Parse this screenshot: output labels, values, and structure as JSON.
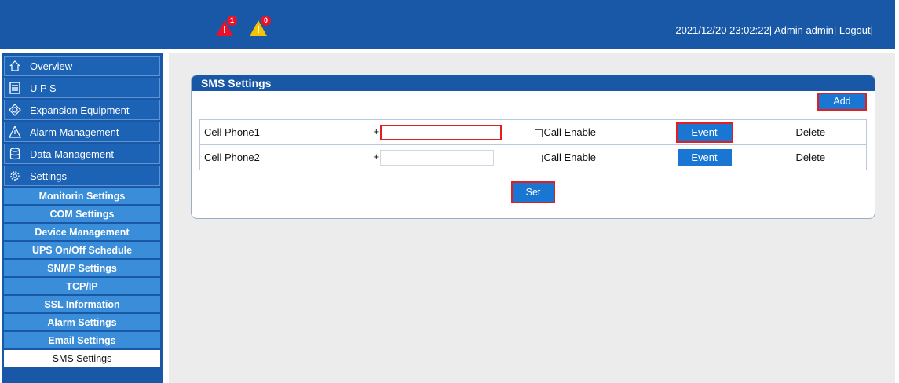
{
  "header": {
    "alarms": [
      {
        "icon": "critical-alarm-icon",
        "count": "1",
        "color": "#e8132a"
      },
      {
        "icon": "warning-alarm-icon",
        "count": "0",
        "color": "#f5c400"
      }
    ],
    "datetime": "2021/12/20 23:02:22|",
    "user": "Admin admin|",
    "logout": "Logout|"
  },
  "sidebar": {
    "main_items": [
      {
        "label": "Overview",
        "icon": "home-icon"
      },
      {
        "label": "U P S",
        "icon": "ups-icon"
      },
      {
        "label": "Expansion Equipment",
        "icon": "expansion-icon"
      },
      {
        "label": "Alarm Management",
        "icon": "alarm-icon"
      },
      {
        "label": "Data Management",
        "icon": "database-icon"
      },
      {
        "label": "Settings",
        "icon": "gear-icon"
      }
    ],
    "sub_items": [
      "Monitorin Settings",
      "COM Settings",
      "Device Management",
      "UPS On/Off Schedule",
      "SNMP Settings",
      "TCP/IP",
      "SSL Information",
      "Alarm Settings",
      "Email Settings",
      "SMS Settings"
    ],
    "active_sub": "SMS Settings"
  },
  "panel": {
    "title": "SMS Settings",
    "add_label": "Add",
    "set_label": "Set",
    "rows": [
      {
        "name": "Cell Phone1",
        "plus": "+",
        "value": "",
        "call_label": "Call Enable",
        "event_label": "Event",
        "delete_label": "Delete"
      },
      {
        "name": "Cell Phone2",
        "plus": "+",
        "value": "",
        "call_label": "Call Enable",
        "event_label": "Event",
        "delete_label": "Delete"
      }
    ]
  },
  "colors": {
    "header": "#1958a6",
    "button": "#1976d2",
    "highlight": "#e02020",
    "sub_nav": "#3a8dd9"
  }
}
